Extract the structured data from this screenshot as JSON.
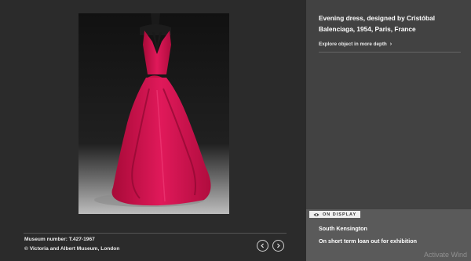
{
  "image": {
    "alt": "Evening dress, designed by Cristóbal Balenciaga",
    "dress_color": "#d4124b",
    "controls": {
      "prev_icon": "chevron-left-icon",
      "next_icon": "chevron-right-icon"
    }
  },
  "caption": {
    "museum_number": "Museum number: T.427-1967",
    "copyright": "© Victoria and Albert Museum, London"
  },
  "info": {
    "title": "Evening dress, designed by Cristóbal Balenciaga, 1954, Paris, France",
    "explore_label": "Explore object in more depth",
    "explore_icon": "chevron-right-icon"
  },
  "display": {
    "badge_label": "ON DISPLAY",
    "badge_icon": "eye-icon",
    "location": "South Kensington",
    "status": "On short term loan out for exhibition"
  },
  "watermark": "Activate Wind",
  "colors": {
    "viewer_bg": "#2b2b2b",
    "panel_bg": "#424242",
    "display_bg": "#5a5a5a"
  }
}
